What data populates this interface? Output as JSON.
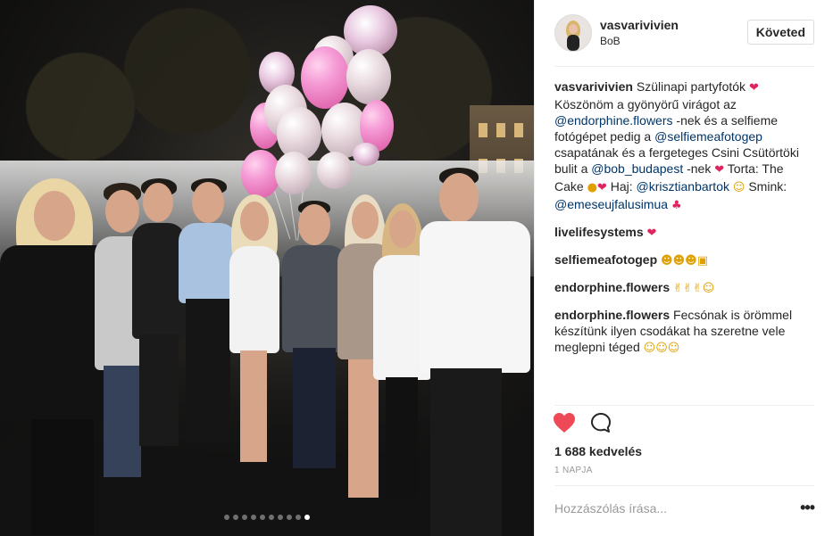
{
  "post": {
    "author": {
      "username": "vasvarivivien",
      "location": "BoB",
      "follow_label": "Követed"
    },
    "comments": [
      {
        "user": "vasvarivivien",
        "parts": [
          {
            "t": "text",
            "v": " Szülinapi partyfotók "
          },
          {
            "t": "emoji",
            "v": "❤",
            "c": "heart"
          },
          {
            "t": "text",
            "v": " Köszönöm a gyönyörű virágot az "
          },
          {
            "t": "mention",
            "v": "@endorphine.flowers"
          },
          {
            "t": "text",
            "v": " -nek és a selfieme fotógépet pedig a "
          },
          {
            "t": "mention",
            "v": "@selfiemeafotogep"
          },
          {
            "t": "text",
            "v": " csapatának és a fergeteges Csini Csütörtöki bulit a "
          },
          {
            "t": "mention",
            "v": "@bob_budapest"
          },
          {
            "t": "text",
            "v": " -nek "
          },
          {
            "t": "emoji",
            "v": "❤",
            "c": "heart"
          },
          {
            "t": "text",
            "v": " Torta: The Cake "
          },
          {
            "t": "emoji",
            "v": "●",
            "c": "cake"
          },
          {
            "t": "emoji",
            "v": "❤",
            "c": "heart"
          },
          {
            "t": "text",
            "v": " Haj: "
          },
          {
            "t": "mention",
            "v": "@krisztianbartok"
          },
          {
            "t": "text",
            "v": " "
          },
          {
            "t": "emoji",
            "v": "☺",
            "c": "face"
          },
          {
            "t": "text",
            "v": " Smink: "
          },
          {
            "t": "mention",
            "v": "@emeseujfalusimua"
          },
          {
            "t": "text",
            "v": " "
          },
          {
            "t": "emoji",
            "v": "♣",
            "c": "heart"
          }
        ]
      },
      {
        "user": "livelifesystems",
        "parts": [
          {
            "t": "text",
            "v": " "
          },
          {
            "t": "emoji",
            "v": "❤",
            "c": "heart"
          }
        ]
      },
      {
        "user": "selfiemeafotogep",
        "parts": [
          {
            "t": "text",
            "v": " "
          },
          {
            "t": "emoji",
            "v": "☻☻☻",
            "c": "face"
          },
          {
            "t": "emoji",
            "v": "▣",
            "c": "cam"
          }
        ]
      },
      {
        "user": "endorphine.flowers",
        "parts": [
          {
            "t": "text",
            "v": " "
          },
          {
            "t": "emoji",
            "v": "✌✌✌",
            "c": "face"
          },
          {
            "t": "emoji",
            "v": "☺",
            "c": "face"
          }
        ]
      },
      {
        "user": "endorphine.flowers",
        "parts": [
          {
            "t": "text",
            "v": " Fecsónak is örömmel készítünk ilyen csodákat ha szeretne vele meglepni téged "
          },
          {
            "t": "emoji",
            "v": "☺☺☺",
            "c": "face"
          }
        ]
      }
    ],
    "likes_text": "1 688 kedvelés",
    "time_text": "1 NAPJA",
    "comment_placeholder": "Hozzászólás írása...",
    "more_label": "•••",
    "carousel": {
      "count": 10,
      "active_index": 9
    }
  },
  "icons": {
    "like": "heart-filled-icon",
    "comment": "speech-bubble-icon"
  },
  "colors": {
    "like_red": "#ed4956",
    "mention_blue": "#003569",
    "text": "#262626",
    "muted": "#999999",
    "border": "#efefef"
  }
}
